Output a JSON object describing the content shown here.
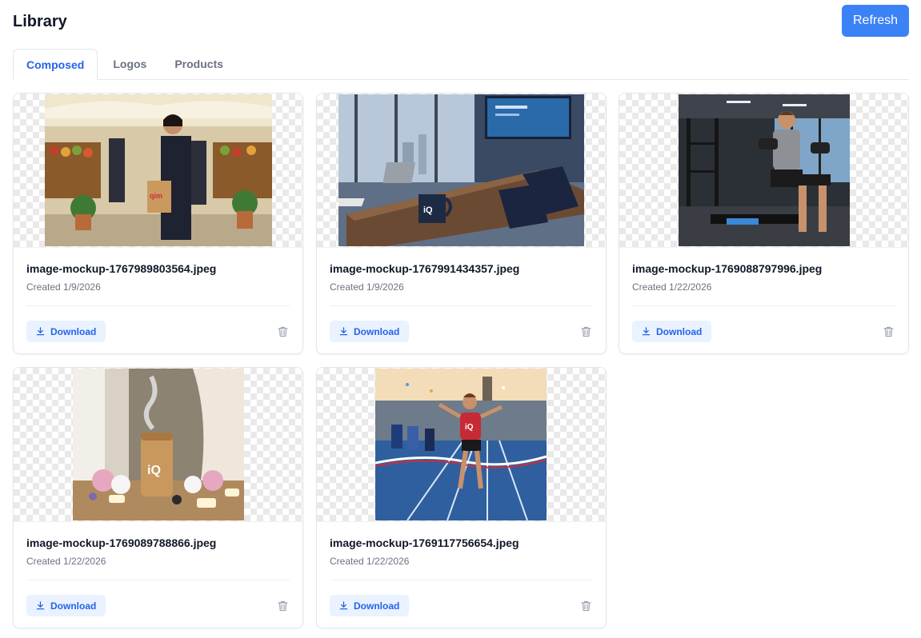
{
  "header": {
    "title": "Library",
    "refresh_label": "Refresh"
  },
  "tabs": [
    {
      "label": "Composed",
      "active": true
    },
    {
      "label": "Logos",
      "active": false
    },
    {
      "label": "Products",
      "active": false
    }
  ],
  "cards": [
    {
      "file_name": "image-mockup-1767989803564.jpeg",
      "created": "Created 1/9/2026",
      "download_label": "Download",
      "image_subject": "market-scene",
      "overlay_text": "qim"
    },
    {
      "file_name": "image-mockup-1767991434357.jpeg",
      "created": "Created 1/9/2026",
      "download_label": "Download",
      "image_subject": "conference-room",
      "overlay_text": "iQ"
    },
    {
      "file_name": "image-mockup-1769088797996.jpeg",
      "created": "Created 1/22/2026",
      "download_label": "Download",
      "image_subject": "gym"
    },
    {
      "file_name": "image-mockup-1769089788866.jpeg",
      "created": "Created 1/22/2026",
      "download_label": "Download",
      "image_subject": "spa-diffuser",
      "overlay_text": "iQ"
    },
    {
      "file_name": "image-mockup-1769117756654.jpeg",
      "created": "Created 1/22/2026",
      "download_label": "Download",
      "image_subject": "runner-finish-line",
      "overlay_text": "iQ"
    }
  ],
  "colors": {
    "accent": "#3b82f6",
    "tab_active": "#2563eb",
    "download_bg": "#eaf2ff"
  },
  "icons": {
    "download": "download-icon",
    "delete": "trash-icon"
  }
}
